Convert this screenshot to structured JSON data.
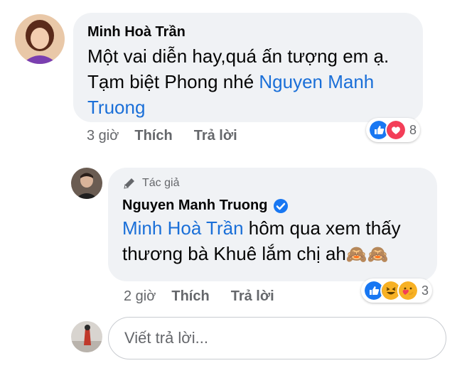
{
  "comment": {
    "author": "Minh Hoà Trần",
    "text_line1": "Một vai diễn hay,quá ấn tượng em ạ.",
    "text_line2_prefix": "Tạm biệt Phong nhé ",
    "mention_part1": "Nguyen Manh",
    "mention_part2": "Truong",
    "time": "3 giờ",
    "like_label": "Thích",
    "reply_label": "Trả lời",
    "reaction_count": "8",
    "reactions": [
      "like",
      "love"
    ]
  },
  "reply": {
    "badge": "Tác giả",
    "author": "Nguyen Manh Truong",
    "verified": true,
    "mention": "Minh Hoà Trần",
    "text_line1_suffix": " hôm qua xem thấy",
    "text_line2": "thương bà Khuê lắm chị ah",
    "emoji": "🙈🙈",
    "time": "2 giờ",
    "like_label": "Thích",
    "reply_label": "Trả lời",
    "reaction_count": "3",
    "reactions": [
      "like",
      "haha",
      "care"
    ]
  },
  "reply_input": {
    "placeholder": "Viết trả lời..."
  },
  "colors": {
    "bubble": "#f0f2f5",
    "mention": "#1a6fd8",
    "like": "#1877f2",
    "love": "#f33e58",
    "haha": "#f7b125"
  }
}
